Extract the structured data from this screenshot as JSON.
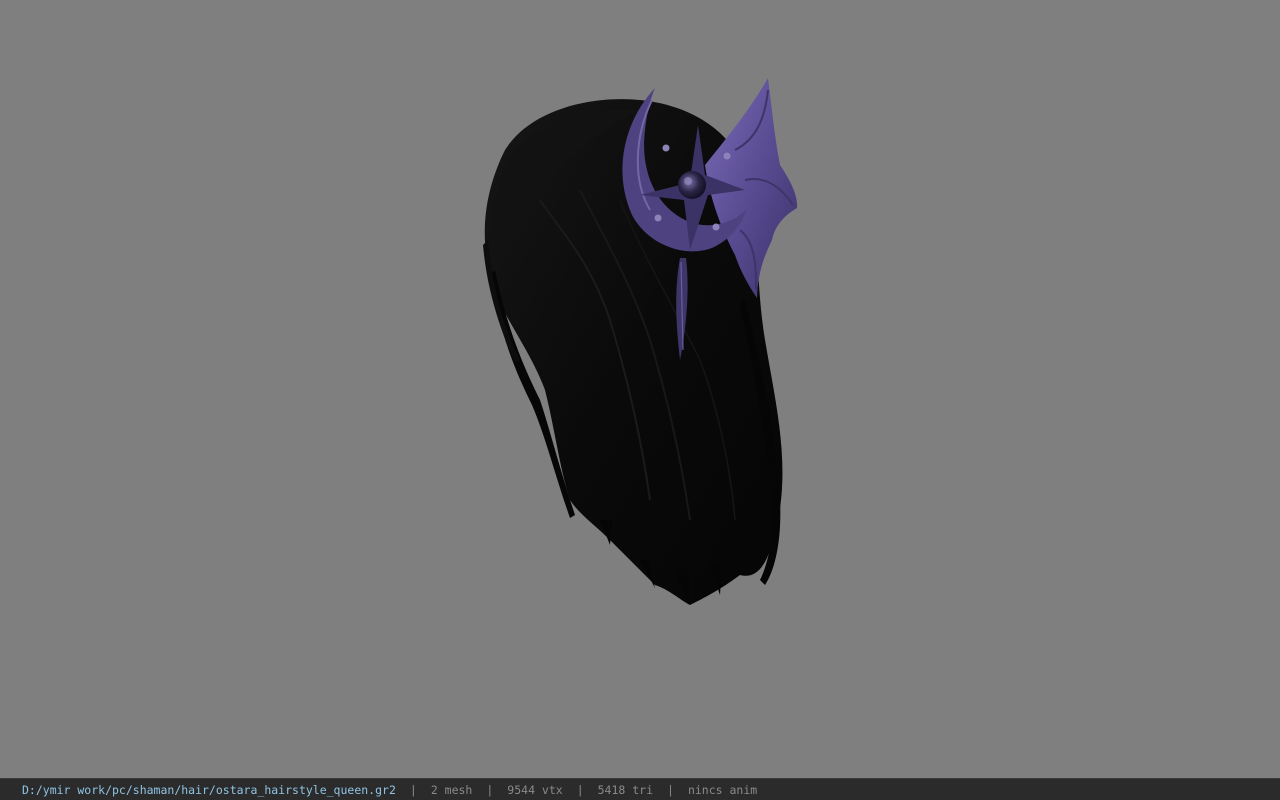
{
  "viewer": {
    "model_name": "ostara hairstyle queen",
    "colors": {
      "background": "#7f7f7f",
      "hair": "#0b0b0b",
      "accessory": "#5d4f94",
      "accessory_dark": "#2e2650",
      "status_bar": "#2b2b2b",
      "path_text": "#8fc4e4",
      "stat_text": "#8a8a8a"
    }
  },
  "status": {
    "path": "D:/ymir work/pc/shaman/hair/ostara_hairstyle_queen.gr2",
    "separator": "|",
    "mesh": "2 mesh",
    "vertices": "9544 vtx",
    "triangles": "5418 tri",
    "anim": "nincs anim"
  }
}
